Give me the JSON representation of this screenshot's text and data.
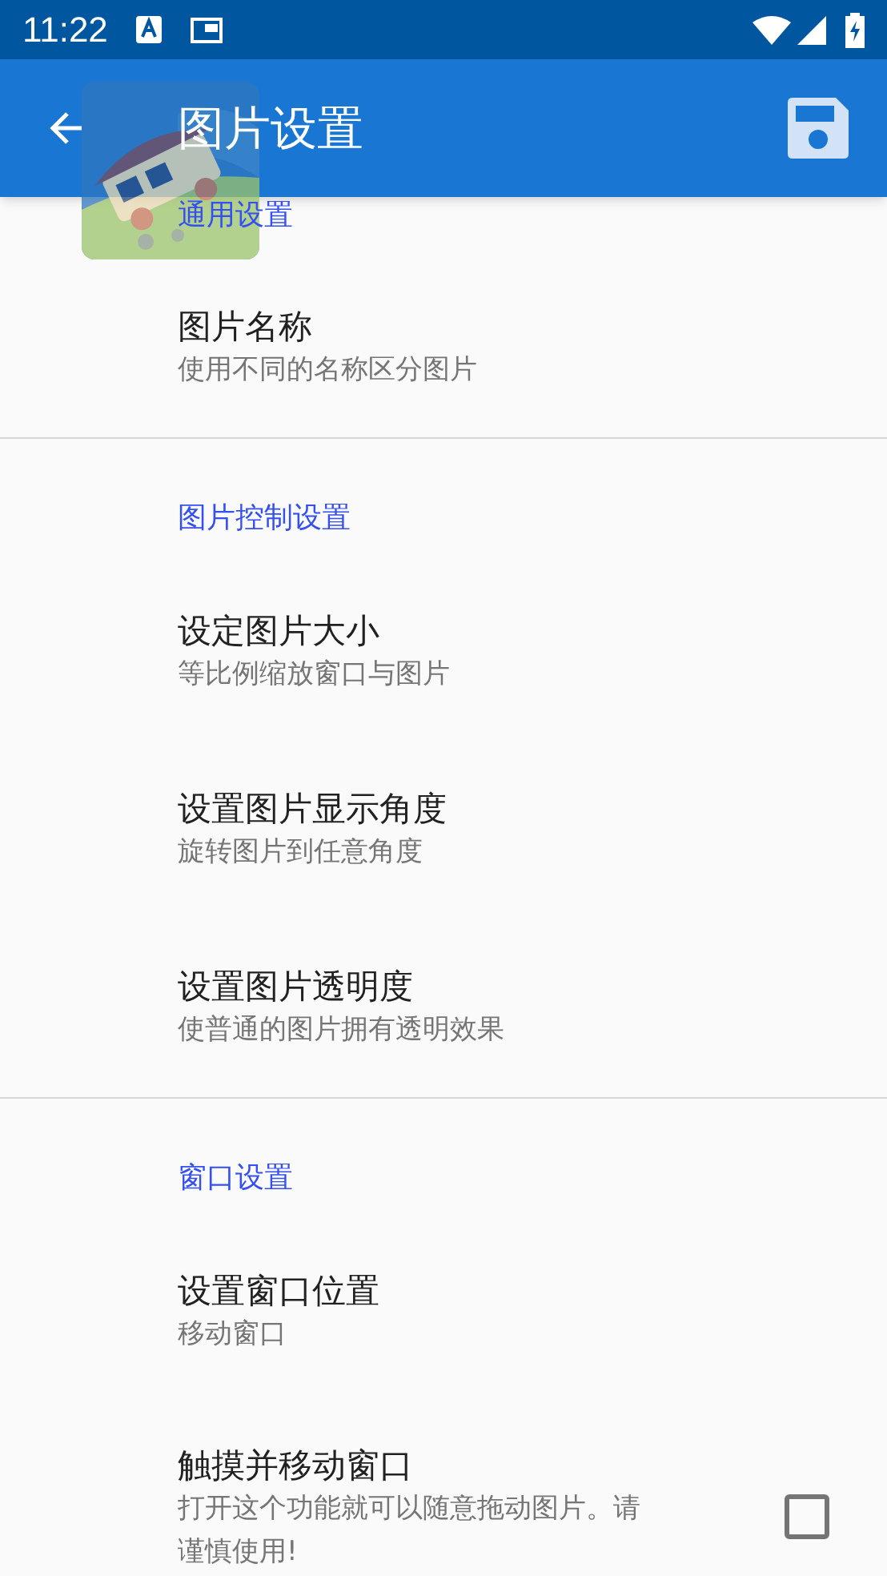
{
  "status_bar": {
    "time": "11:22"
  },
  "toolbar": {
    "title": "图片设置"
  },
  "sections": [
    {
      "category": "通用设置",
      "items": [
        {
          "kind": "plain",
          "title": "图片名称",
          "summary": "使用不同的名称区分图片"
        }
      ]
    },
    {
      "category": "图片控制设置",
      "items": [
        {
          "kind": "plain",
          "title": "设定图片大小",
          "summary": "等比例缩放窗口与图片"
        },
        {
          "kind": "plain",
          "title": "设置图片显示角度",
          "summary": "旋转图片到任意角度"
        },
        {
          "kind": "plain",
          "title": "设置图片透明度",
          "summary": "使普通的图片拥有透明效果"
        }
      ]
    },
    {
      "category": "窗口设置",
      "items": [
        {
          "kind": "plain",
          "title": "设置窗口位置",
          "summary": "移动窗口"
        },
        {
          "kind": "checkbox",
          "title": "触摸并移动窗口",
          "summary": "打开这个功能就可以随意拖动图片。请谨慎使用!",
          "checked": false
        }
      ]
    }
  ]
}
